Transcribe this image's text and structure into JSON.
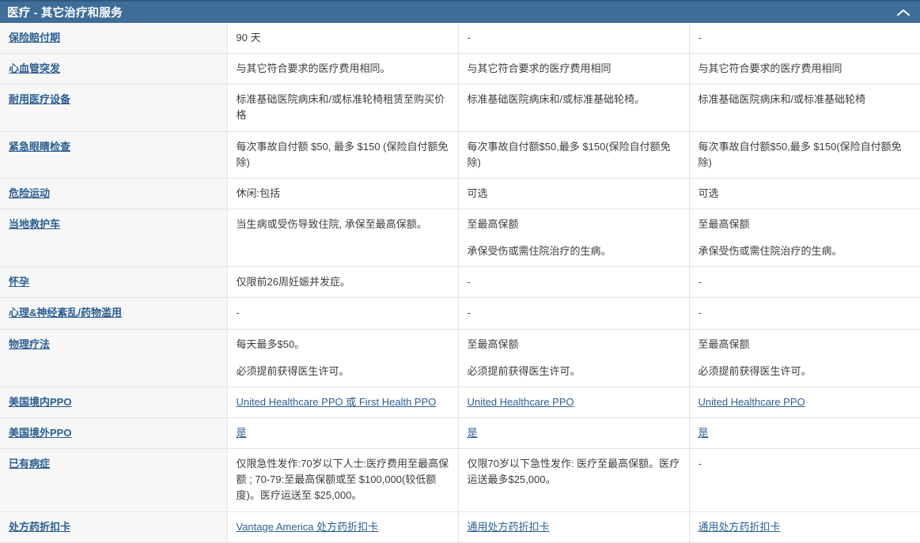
{
  "header": {
    "title": "医疗 - 其它治疗和服务",
    "collapse_icon": "chevron-up-icon",
    "bar_color": "#3f6d9a",
    "title_color": "#ffffff"
  },
  "theme": {
    "link_color": "#2c5f94",
    "label_column_bg": "#f7f7f7",
    "row_border": "#e3e3e3"
  },
  "table": {
    "rows": [
      {
        "label": "保险赔付期",
        "label_is_link": true,
        "cells": [
          {
            "lines": [
              "90 天"
            ]
          },
          {
            "lines": [
              "-"
            ]
          },
          {
            "lines": [
              "-"
            ]
          }
        ]
      },
      {
        "label": "心血管突发",
        "label_is_link": true,
        "cells": [
          {
            "lines": [
              "与其它符合要求的医疗费用相同。"
            ]
          },
          {
            "lines": [
              "与其它符合要求的医疗费用相同"
            ]
          },
          {
            "lines": [
              "与其它符合要求的医疗费用相同"
            ]
          }
        ]
      },
      {
        "label": "耐用医疗设备",
        "label_is_link": true,
        "cells": [
          {
            "lines": [
              "标准基础医院病床和/或标准轮椅租赁至购买价格"
            ]
          },
          {
            "lines": [
              "标准基础医院病床和/或标准基础轮椅。"
            ]
          },
          {
            "lines": [
              "标准基础医院病床和/或标准基础轮椅"
            ]
          }
        ]
      },
      {
        "label": "紧急眼睛检查",
        "label_is_link": true,
        "cells": [
          {
            "lines": [
              "每次事故自付额 $50, 最多 $150 (保险自付额免除)"
            ]
          },
          {
            "lines": [
              "每次事故自付额$50,最多 $150(保险自付额免除)"
            ]
          },
          {
            "lines": [
              "每次事故自付额$50,最多 $150(保险自付额免除)"
            ]
          }
        ]
      },
      {
        "label": "危险运动",
        "label_is_link": true,
        "cells": [
          {
            "lines": [
              "休闲:包括"
            ]
          },
          {
            "lines": [
              "可选"
            ]
          },
          {
            "lines": [
              "可选"
            ]
          }
        ]
      },
      {
        "label": "当地救护车",
        "label_is_link": true,
        "cells": [
          {
            "lines": [
              "当生病或受伤导致住院, 承保至最高保额。"
            ]
          },
          {
            "lines": [
              "至最高保额",
              "承保受伤或需住院治疗的生病。"
            ]
          },
          {
            "lines": [
              "至最高保额",
              "承保受伤或需住院治疗的生病。"
            ]
          }
        ]
      },
      {
        "label": "怀孕",
        "label_is_link": true,
        "cells": [
          {
            "lines": [
              "仅限前26周妊娠并发症。"
            ]
          },
          {
            "lines": [
              "-"
            ]
          },
          {
            "lines": [
              "-"
            ]
          }
        ]
      },
      {
        "label": "心理&神经紊乱/药物滥用",
        "label_is_link": true,
        "cells": [
          {
            "lines": [
              "-"
            ]
          },
          {
            "lines": [
              "-"
            ]
          },
          {
            "lines": [
              "-"
            ]
          }
        ]
      },
      {
        "label": "物理疗法",
        "label_is_link": true,
        "cells": [
          {
            "lines": [
              "每天最多$50。",
              "必须提前获得医生许可。"
            ]
          },
          {
            "lines": [
              "至最高保额",
              "必须提前获得医生许可。"
            ]
          },
          {
            "lines": [
              "至最高保额",
              "必须提前获得医生许可。"
            ]
          }
        ]
      },
      {
        "label": "美国境内PPO",
        "label_is_link": true,
        "cells": [
          {
            "lines": [
              "United Healthcare PPO 或 First Health PPO"
            ],
            "link": true
          },
          {
            "lines": [
              "United Healthcare PPO"
            ],
            "link": true
          },
          {
            "lines": [
              "United Healthcare PPO"
            ],
            "link": true
          }
        ]
      },
      {
        "label": "美国境外PPO",
        "label_is_link": true,
        "cells": [
          {
            "lines": [
              "是"
            ],
            "link": true
          },
          {
            "lines": [
              "是"
            ],
            "link": true
          },
          {
            "lines": [
              "是"
            ],
            "link": true
          }
        ]
      },
      {
        "label": "已有病症",
        "label_is_link": true,
        "cells": [
          {
            "lines": [
              "仅限急性发作:70岁以下人士:医疗费用至最高保额 ; 70-79:至最高保额或至 $100,000(较低额度)。医疗运送至 $25,000。"
            ]
          },
          {
            "lines": [
              "仅限70岁以下急性发作: 医疗至最高保额。医疗运送最多$25,000。"
            ]
          },
          {
            "lines": [
              "-"
            ]
          }
        ]
      },
      {
        "label": "处方药折扣卡",
        "label_is_link": true,
        "cells": [
          {
            "lines": [
              "Vantage America 处方药折扣卡"
            ],
            "link": true
          },
          {
            "lines": [
              "通用处方药折扣卡"
            ],
            "link": true
          },
          {
            "lines": [
              "通用处方药折扣卡"
            ],
            "link": true
          }
        ]
      }
    ]
  }
}
